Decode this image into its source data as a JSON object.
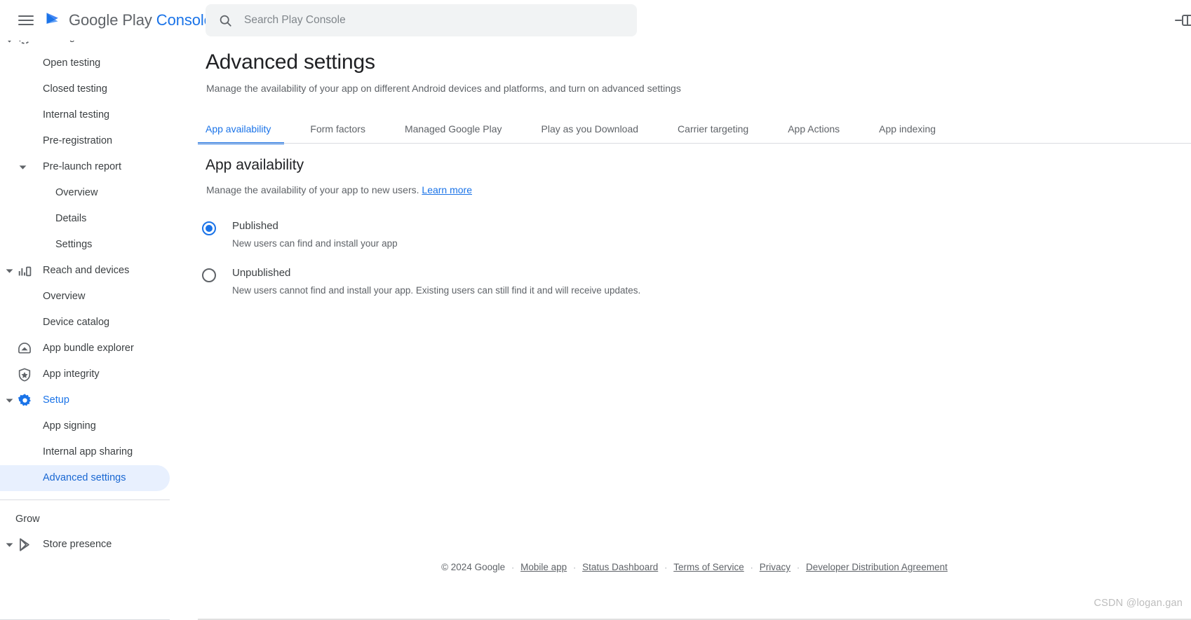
{
  "header": {
    "menu_icon": "hamburger-menu-icon",
    "logo_icon": "google-play-logo-icon",
    "brand_primary": "Google Play",
    "brand_accent": "Console",
    "search_icon": "search-icon",
    "search_placeholder": "Search Play Console",
    "search_value": "",
    "right_icon": "collapse-panel-icon"
  },
  "sidebar": {
    "items": [
      {
        "label": "Testing",
        "level": "icon",
        "icon": "testing-icon",
        "caret": "down",
        "state": "normal",
        "clipped": true
      },
      {
        "label": "Open testing",
        "level": "1",
        "caret": "none",
        "state": "normal"
      },
      {
        "label": "Closed testing",
        "level": "1",
        "caret": "none",
        "state": "normal"
      },
      {
        "label": "Internal testing",
        "level": "1",
        "caret": "none",
        "state": "normal"
      },
      {
        "label": "Pre-registration",
        "level": "1",
        "caret": "none",
        "state": "normal"
      },
      {
        "label": "Pre-launch report",
        "level": "1",
        "caret": "down-sub",
        "state": "normal"
      },
      {
        "label": "Overview",
        "level": "2",
        "caret": "none",
        "state": "normal"
      },
      {
        "label": "Details",
        "level": "2",
        "caret": "none",
        "state": "normal"
      },
      {
        "label": "Settings",
        "level": "2",
        "caret": "none",
        "state": "normal"
      },
      {
        "label": "Reach and devices",
        "level": "icon",
        "icon": "bar-chart-icon",
        "caret": "down",
        "state": "normal"
      },
      {
        "label": "Overview",
        "level": "1",
        "caret": "none",
        "state": "normal"
      },
      {
        "label": "Device catalog",
        "level": "1",
        "caret": "none",
        "state": "normal"
      },
      {
        "label": "App bundle explorer",
        "level": "icon",
        "icon": "app-bundle-icon",
        "caret": "none",
        "state": "normal"
      },
      {
        "label": "App integrity",
        "level": "icon",
        "icon": "shield-star-icon",
        "caret": "none",
        "state": "normal"
      },
      {
        "label": "Setup",
        "level": "icon",
        "icon": "gear-icon",
        "caret": "down",
        "state": "active"
      },
      {
        "label": "App signing",
        "level": "1",
        "caret": "none",
        "state": "normal"
      },
      {
        "label": "Internal app sharing",
        "level": "1",
        "caret": "none",
        "state": "normal"
      },
      {
        "label": "Advanced settings",
        "level": "1",
        "caret": "none",
        "state": "selected"
      }
    ],
    "section_label": "Grow",
    "grow_items": [
      {
        "label": "Store presence",
        "level": "icon",
        "icon": "store-presence-icon",
        "caret": "down",
        "state": "normal"
      }
    ]
  },
  "main": {
    "title": "Advanced settings",
    "subtitle": "Manage the availability of your app on different Android devices and platforms, and turn on advanced settings",
    "tabs": [
      {
        "label": "App availability",
        "active": true
      },
      {
        "label": "Form factors",
        "active": false
      },
      {
        "label": "Managed Google Play",
        "active": false
      },
      {
        "label": "Play as you Download",
        "active": false
      },
      {
        "label": "Carrier targeting",
        "active": false
      },
      {
        "label": "App Actions",
        "active": false
      },
      {
        "label": "App indexing",
        "active": false
      }
    ],
    "section": {
      "title": "App availability",
      "subtitle_text": "Manage the availability of your app to new users.",
      "learn_more": "Learn more"
    },
    "availability_options": [
      {
        "label": "Published",
        "description": "New users can find and install your app",
        "selected": true
      },
      {
        "label": "Unpublished",
        "description": "New users cannot find and install your app. Existing users can still find it and will receive updates.",
        "selected": false
      }
    ]
  },
  "footer": {
    "copyright": "© 2024 Google",
    "links": [
      "Mobile app",
      "Status Dashboard",
      "Terms of Service",
      "Privacy",
      "Developer Distribution Agreement"
    ]
  },
  "watermark": "CSDN @logan.gan",
  "colors": {
    "accent_blue": "#1a73e8",
    "selected_pill": "#e8f0fe",
    "text_primary": "#202124",
    "text_secondary": "#5f6368",
    "divider": "#dadce0"
  }
}
